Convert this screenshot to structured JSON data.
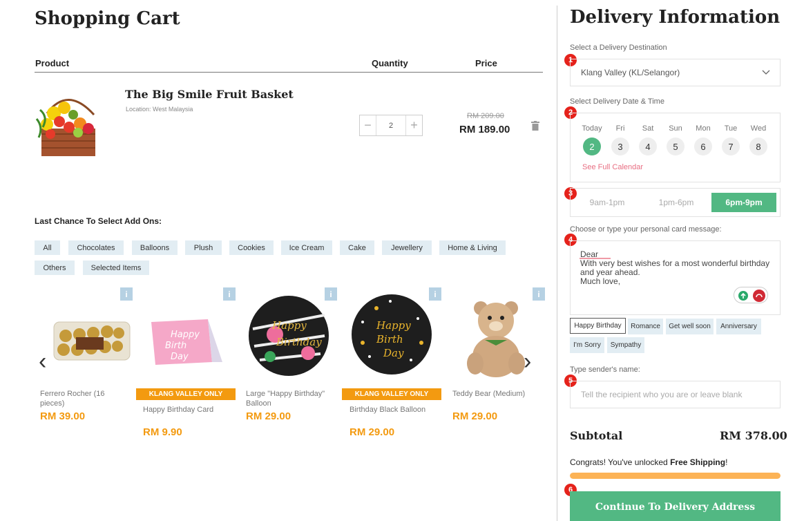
{
  "cart": {
    "title": "Shopping Cart",
    "columns": {
      "product": "Product",
      "quantity": "Quantity",
      "price": "Price"
    },
    "item": {
      "name": "The Big Smile Fruit Basket",
      "location": "Location: West Malaysia",
      "quantity": "2",
      "old_price": "RM 209.00",
      "price": "RM 189.00"
    },
    "stepper": {
      "minus": "−",
      "plus": "+"
    }
  },
  "addons": {
    "title": "Last Chance To Select Add Ons:",
    "categories": [
      "All",
      "Chocolates",
      "Balloons",
      "Plush",
      "Cookies",
      "Ice Cream",
      "Cake",
      "Jewellery",
      "Home & Living",
      "Others",
      "Selected Items"
    ],
    "info": "i",
    "products": [
      {
        "name": "Ferrero Rocher (16 pieces)",
        "price": "RM 39.00",
        "ribbon": ""
      },
      {
        "name": "Happy Birthday Card",
        "price": "RM 9.90",
        "ribbon": "KLANG VALLEY ONLY"
      },
      {
        "name": "Large \"Happy Birthday\" Balloon",
        "price": "RM 29.00",
        "ribbon": ""
      },
      {
        "name": "Birthday Black Balloon",
        "price": "RM 29.00",
        "ribbon": "KLANG VALLEY ONLY"
      },
      {
        "name": "Teddy Bear (Medium)",
        "price": "RM 29.00",
        "ribbon": ""
      }
    ],
    "arrows": {
      "prev": "‹",
      "next": "›"
    }
  },
  "delivery": {
    "title": "Delivery Information",
    "steps": [
      "1",
      "2",
      "3",
      "4",
      "5",
      "6"
    ],
    "destination_label": "Select a Delivery Destination",
    "destination_value": "Klang Valley (KL/Selangor)",
    "date_label": "Select Delivery Date & Time",
    "days": [
      {
        "day": "Today",
        "date": "2"
      },
      {
        "day": "Fri",
        "date": "3"
      },
      {
        "day": "Sat",
        "date": "4"
      },
      {
        "day": "Sun",
        "date": "5"
      },
      {
        "day": "Mon",
        "date": "6"
      },
      {
        "day": "Tue",
        "date": "7"
      },
      {
        "day": "Wed",
        "date": "8"
      }
    ],
    "full_calendar": "See Full Calendar",
    "time_slots": [
      "9am-1pm",
      "1pm-6pm",
      "6pm-9pm"
    ],
    "message_label": "Choose or type your personal card message:",
    "message_lines": [
      "Dear",
      "With very best wishes for a most wonderful birthday",
      "and year ahead.",
      "Much love,"
    ],
    "occasions": [
      "Happy Birthday",
      "Romance",
      "Get well soon",
      "Anniversary",
      "I'm Sorry",
      "Sympathy"
    ],
    "sender_label": "Type sender's name:",
    "sender_placeholder": "Tell the recipient who you are or leave blank",
    "subtotal_label": "Subtotal",
    "subtotal_value": "RM 378.00",
    "congrats_prefix": "Congrats! You've unlocked ",
    "congrats_bold": "Free Shipping",
    "congrats_suffix": "!",
    "shipping_progress": 1.0,
    "cta": "Continue To Delivery Address"
  },
  "colors": {
    "green": "#52b883",
    "orange": "#f39a10",
    "badge_red": "#e5221b",
    "chip_blue": "#e2edf3",
    "progress": "#fcb356"
  }
}
